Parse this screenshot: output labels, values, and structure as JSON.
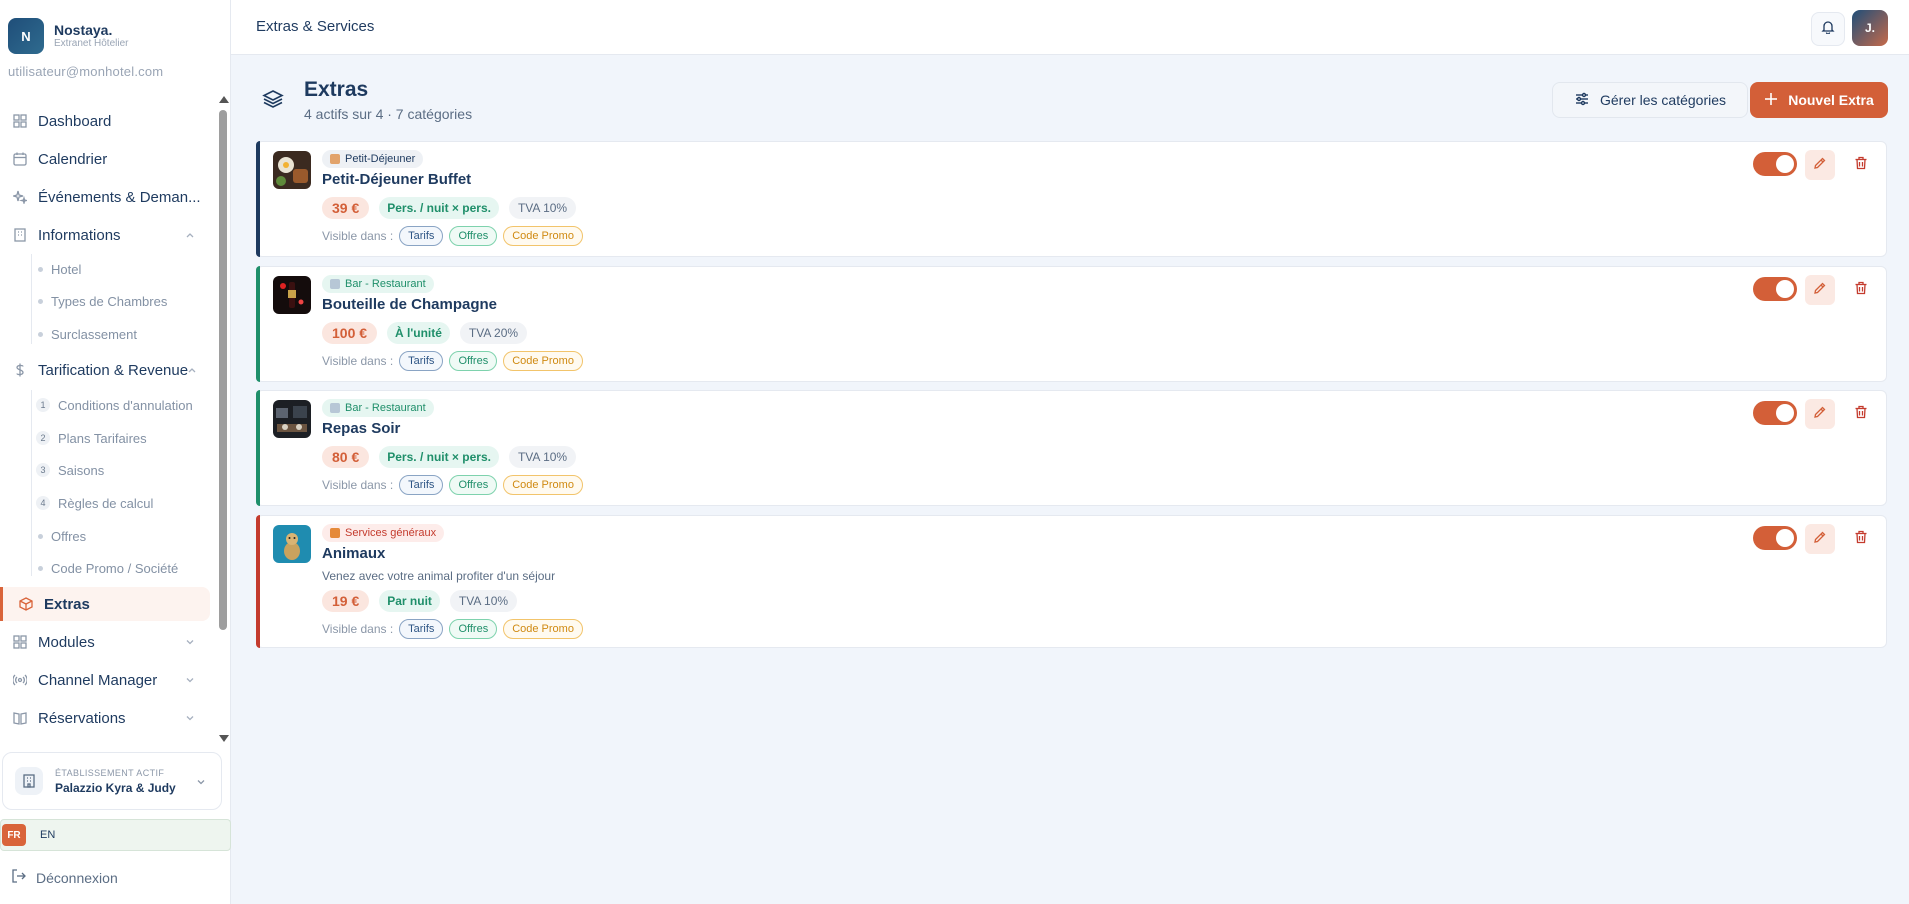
{
  "brand": {
    "logo_letter": "N",
    "name": "Nostaya.",
    "subtitle": "Extranet Hôtelier"
  },
  "user": {
    "email": "utilisateur@monhotel.com",
    "avatar_initial": "J."
  },
  "sidebar": {
    "nav": {
      "dashboard": "Dashboard",
      "calendrier": "Calendrier",
      "evenements": "Événements & Deman...",
      "informations": "Informations",
      "tarification": "Tarification & Revenue",
      "extras": "Extras",
      "modules": "Modules",
      "channel": "Channel Manager",
      "reservations": "Réservations"
    },
    "informations_sub": [
      "Hotel",
      "Types de Chambres",
      "Surclassement"
    ],
    "tarification_sub": [
      {
        "num": "1",
        "label": "Conditions d'annulation"
      },
      {
        "num": "2",
        "label": "Plans Tarifaires"
      },
      {
        "num": "3",
        "label": "Saisons"
      },
      {
        "num": "4",
        "label": "Règles de calcul"
      },
      {
        "num": "",
        "label": "Offres"
      },
      {
        "num": "",
        "label": "Code Promo / Société"
      }
    ],
    "establishment": {
      "label": "ÉTABLISSEMENT ACTIF",
      "name": "Palazzio Kyra & Judy"
    },
    "languages": {
      "fr": "FR",
      "en": "EN"
    },
    "logout": "Déconnexion"
  },
  "topbar": {
    "title": "Extras & Services"
  },
  "main": {
    "title": "Extras",
    "subtitle": "4 actifs sur 4 · 7 catégories",
    "manage_categories": "Gérer les catégories",
    "new_extra": "Nouvel Extra",
    "visible_label": "Visible dans :",
    "tags": {
      "tarifs": "Tarifs",
      "offres": "Offres",
      "promo": "Code Promo"
    }
  },
  "extras": [
    {
      "category": "Petit-Déjeuner",
      "name": "Petit-Déjeuner Buffet",
      "description": "",
      "price": "39 €",
      "unit": "Pers. / nuit × pers.",
      "tva": "TVA 10%",
      "accent": "#1e3a5f",
      "active": true
    },
    {
      "category": "Bar - Restaurant",
      "name": "Bouteille de Champagne",
      "description": "",
      "price": "100 €",
      "unit": "À l'unité",
      "tva": "TVA 20%",
      "accent": "#1f8f6a",
      "active": true
    },
    {
      "category": "Bar - Restaurant",
      "name": "Repas Soir",
      "description": "",
      "price": "80 €",
      "unit": "Pers. / nuit × pers.",
      "tva": "TVA 10%",
      "accent": "#1f8f6a",
      "active": true
    },
    {
      "category": "Services généraux",
      "name": "Animaux",
      "description": "Venez avec votre animal profiter d'un séjour",
      "price": "19 €",
      "unit": "Par nuit",
      "tva": "TVA 10%",
      "accent": "#c43b2d",
      "active": true
    }
  ],
  "colors": {
    "accent": "#d35f38",
    "brand": "#1e3a5f",
    "success": "#1f8f6a",
    "danger": "#c43b2d"
  }
}
